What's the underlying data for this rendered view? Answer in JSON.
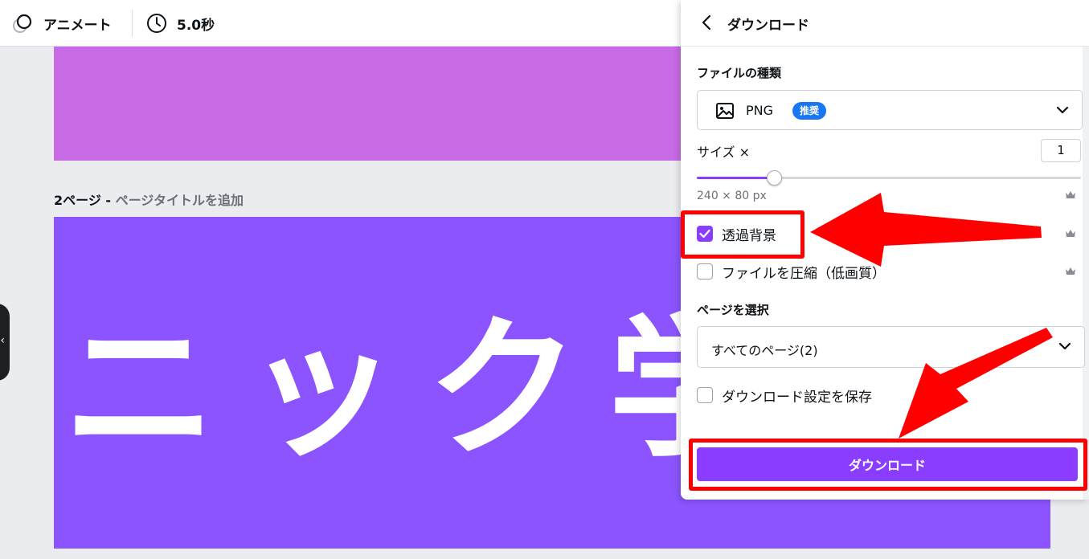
{
  "toolbar": {
    "animate_label": "アニメート",
    "duration_label": "5.0秒"
  },
  "canvas": {
    "page2_number": "2ページ -",
    "page2_title_placeholder": "ページタイトルを追加",
    "page2_text": "ニック学SW"
  },
  "panel": {
    "title": "ダウンロード",
    "file_type_label": "ファイルの種類",
    "file_type_value": "PNG",
    "recommended_badge": "推奨",
    "size_label": "サイズ ×",
    "size_value": "1",
    "size_slider_fraction": 0.2,
    "dimensions": "240 × 80 px",
    "transparent_bg_label": "透過背景",
    "transparent_bg_checked": true,
    "compress_label": "ファイルを圧縮（低画質）",
    "compress_checked": false,
    "select_pages_label": "ページを選択",
    "pages_value": "すべてのページ(2)",
    "save_settings_label": "ダウンロード設定を保存",
    "save_settings_checked": false,
    "download_button": "ダウンロード"
  },
  "colors": {
    "accent": "#8b3dff",
    "badge": "#1877f2",
    "page1_bg": "#c86ae6",
    "page2_bg": "#8b54ff",
    "annotation": "#ff0000"
  },
  "icons": {
    "animate": "animate-circles-icon",
    "clock": "clock-icon",
    "back": "chevron-left-icon",
    "image": "image-icon",
    "dropdown": "chevron-down-icon",
    "premium": "crown-icon",
    "check": "checkmark-icon"
  }
}
